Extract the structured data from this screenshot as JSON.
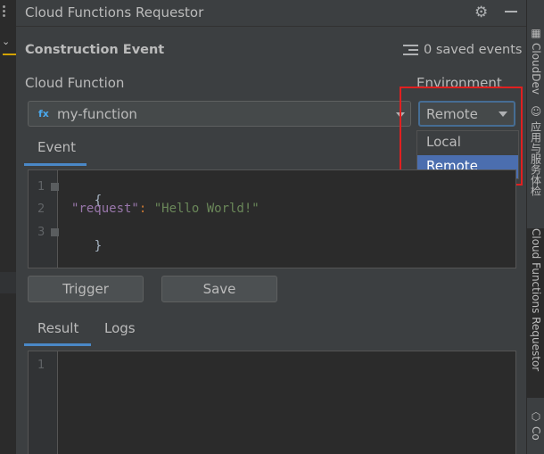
{
  "panel": {
    "title": "Cloud Functions Requestor"
  },
  "construction": {
    "title": "Construction Event",
    "saved_events": "0 saved events"
  },
  "cloud_function": {
    "label": "Cloud Function",
    "icon_text": "fx",
    "value": "my-function"
  },
  "environment": {
    "label": "Environment",
    "value": "Remote",
    "options": [
      "Local",
      "Remote"
    ],
    "selected_option": "Remote"
  },
  "event_tab": {
    "label": "Event"
  },
  "event_code": {
    "line_numbers": [
      "1",
      "2",
      "3"
    ],
    "open_brace": "{",
    "key": "\"request\"",
    "colon": ": ",
    "value": "\"Hello World!\"",
    "close_brace": "}"
  },
  "buttons": {
    "trigger": "Trigger",
    "save": "Save"
  },
  "output_tabs": {
    "result": "Result",
    "logs": "Logs",
    "active": "Result"
  },
  "result_code": {
    "line_numbers": [
      "1"
    ]
  },
  "right_strip": {
    "tabs": [
      "CloudDev",
      "应用与服务体检",
      "Cloud Functions Requestor",
      "Co"
    ]
  },
  "colors": {
    "accent": "#4a88c7",
    "selection": "#4b6eaf",
    "highlight": "#e02020",
    "background": "#3c3f41"
  }
}
